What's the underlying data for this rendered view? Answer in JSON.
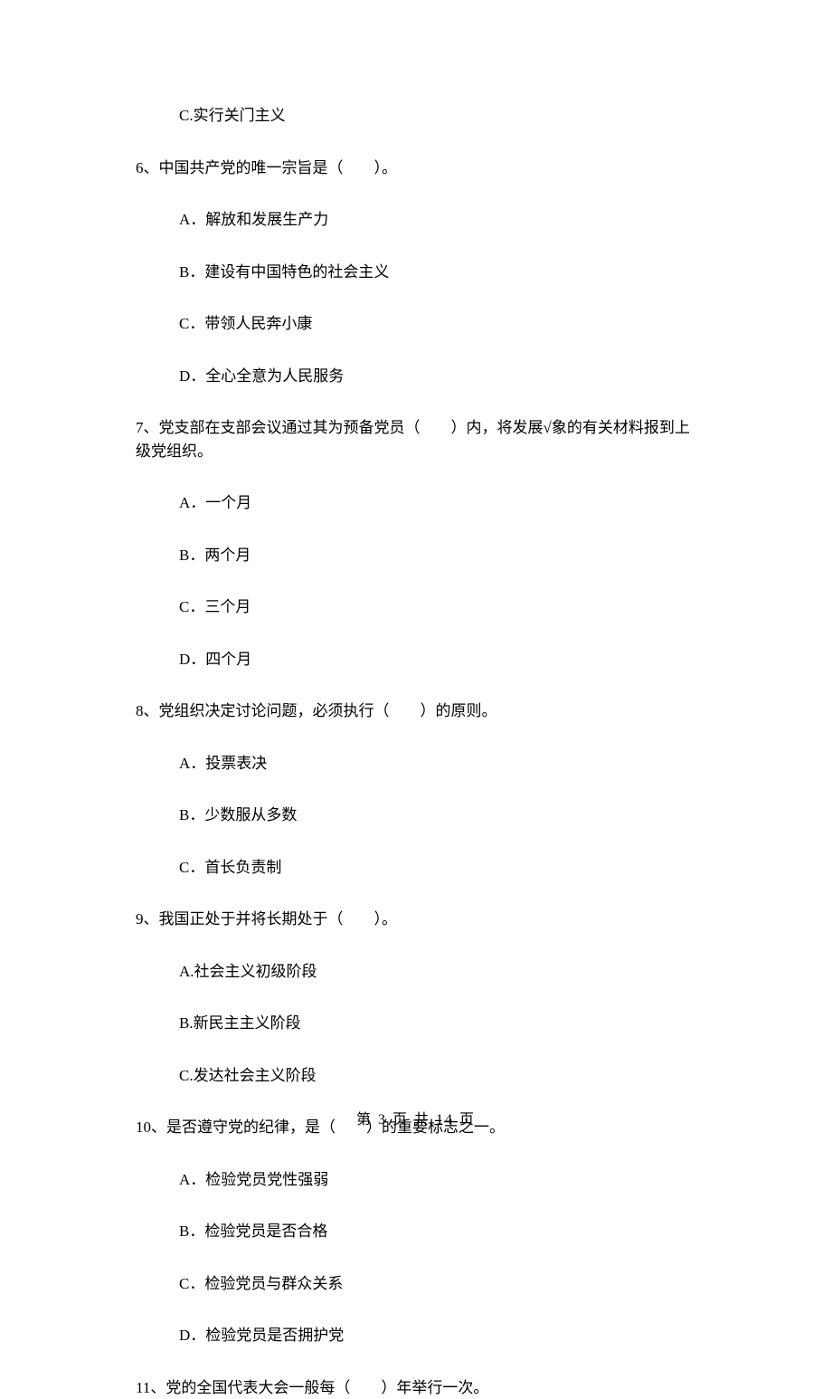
{
  "continuation": {
    "option_c": "C.实行关门主义"
  },
  "q6": {
    "text": "6、中国共产党的唯一宗旨是（　　）。",
    "a": "A．解放和发展生产力",
    "b": "B．建设有中国特色的社会主义",
    "c": "C．带领人民奔小康",
    "d": "D．全心全意为人民服务"
  },
  "q7": {
    "text": "7、党支部在支部会议通过其为预备党员（　　）内，将发展√象的有关材料报到上级党组织。",
    "a": "A．一个月",
    "b": "B．两个月",
    "c": "C．三个月",
    "d": "D．四个月"
  },
  "q8": {
    "text": "8、党组织决定讨论问题，必须执行（　　）的原则。",
    "a": "A．投票表决",
    "b": "B．少数服从多数",
    "c": "C．首长负责制"
  },
  "q9": {
    "text": "9、我国正处于并将长期处于（　　）。",
    "a": "A.社会主义初级阶段",
    "b": "B.新民主主义阶段",
    "c": "C.发达社会主义阶段"
  },
  "q10": {
    "text": "10、是否遵守党的纪律，是（　　）的重要标志之一。",
    "a": "A．检验党员党性强弱",
    "b": "B．检验党员是否合格",
    "c": "C．检验党员与群众关系",
    "d": "D．检验党员是否拥护党"
  },
  "q11": {
    "text": "11、党的全国代表大会一般每（　　）年举行一次。"
  },
  "footer": "第 3 页 共 14 页"
}
